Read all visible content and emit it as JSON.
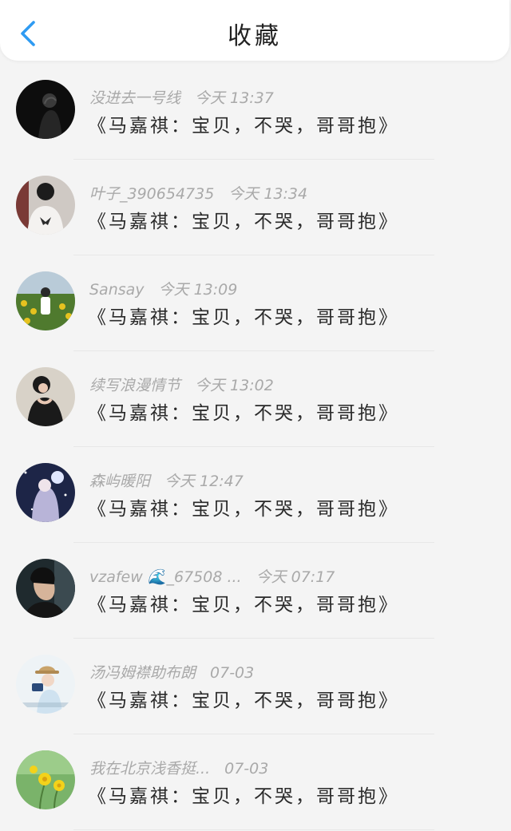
{
  "header": {
    "title": "收藏"
  },
  "colors": {
    "accent": "#2f9bf2",
    "background": "#f4f4f4",
    "name_text": "#a9a9a9",
    "message_text": "#2a2a2a"
  },
  "items": [
    {
      "name": "没进去一号线",
      "time": "今天 13:37",
      "message": "《马嘉祺：宝贝，不哭，哥哥抱》",
      "avatar": "avatar-dark-portrait"
    },
    {
      "name": "叶子_390654735",
      "time": "今天 13:34",
      "message": "《马嘉祺：宝贝，不哭，哥哥抱》",
      "avatar": "avatar-butterfly-shirt"
    },
    {
      "name": "Sansay",
      "time": "今天 13:09",
      "message": "《马嘉祺：宝贝，不哭，哥哥抱》",
      "avatar": "avatar-sunflower-field"
    },
    {
      "name": "续写浪漫情节",
      "time": "今天 13:02",
      "message": "《马嘉祺：宝贝，不哭，哥哥抱》",
      "avatar": "avatar-black-dress"
    },
    {
      "name": "森屿暖阳",
      "time": "今天 12:47",
      "message": "《马嘉祺：宝贝，不哭，哥哥抱》",
      "avatar": "avatar-anime-night"
    },
    {
      "name": "vzafew 🌊_67508 ...",
      "time": "今天 07:17",
      "message": "《马嘉祺：宝贝，不哭，哥哥抱》",
      "avatar": "avatar-man-portrait"
    },
    {
      "name": "汤冯姆襟助布朗",
      "time": "07-03",
      "message": "《马嘉祺：宝贝，不哭，哥哥抱》",
      "avatar": "avatar-camera-girl"
    },
    {
      "name": "我在北京浅香挺...",
      "time": "07-03",
      "message": "《马嘉祺：宝贝，不哭，哥哥抱》",
      "avatar": "avatar-yellow-flowers"
    }
  ]
}
